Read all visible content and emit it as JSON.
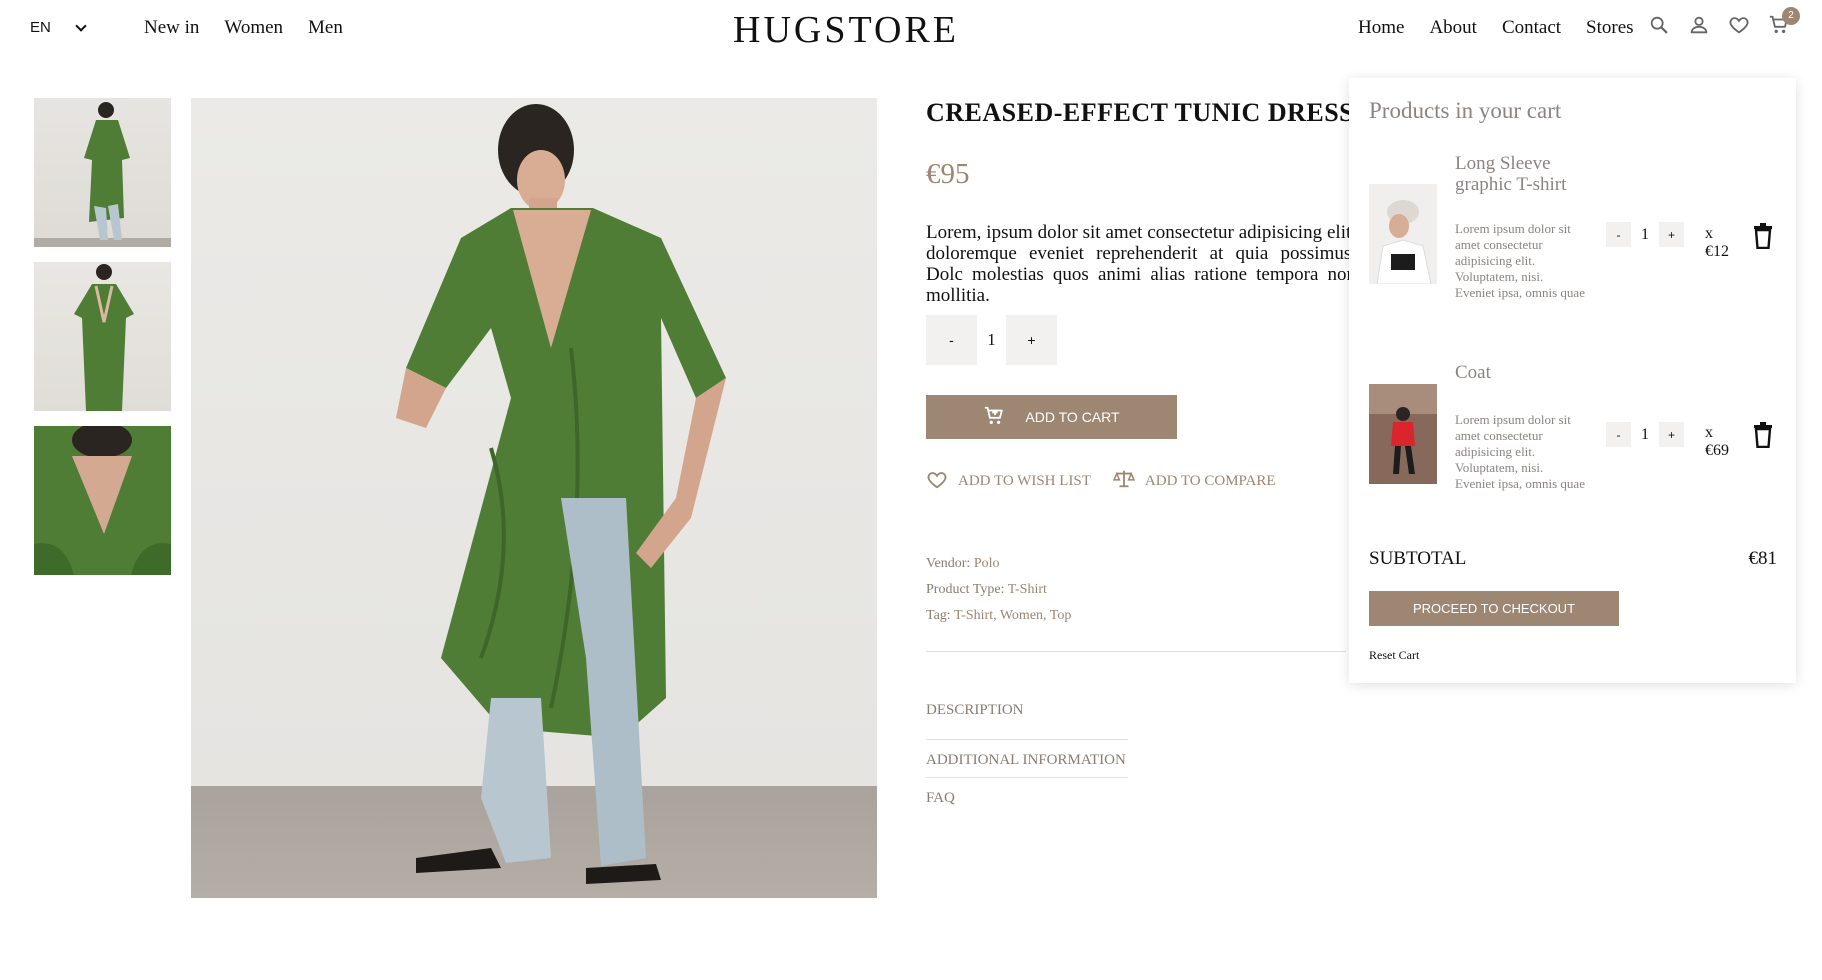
{
  "header": {
    "language": "EN",
    "nav_left": [
      "New in",
      "Women",
      "Men"
    ],
    "logo": "HUGSTORE",
    "nav_right": [
      "Home",
      "About",
      "Contact",
      "Stores"
    ],
    "cart_count": "2",
    "icons": [
      "search-icon",
      "user-icon",
      "heart-icon",
      "cart-icon"
    ]
  },
  "product": {
    "title": "CREASED-EFFECT TUNIC DRESS",
    "price": "€95",
    "description": "Lorem, ipsum dolor sit amet consectetur adipisicing elit. doloremque eveniet reprehenderit at quia possimus. Dolc molestias quos animi alias ratione tempora non mollitia.",
    "quantity": "1",
    "minus_label": "-",
    "plus_label": "+",
    "add_to_cart": "ADD TO CART",
    "wishlist": "ADD TO WISH LIST",
    "compare": "ADD TO COMPARE",
    "vendor_label": "Vendor:",
    "vendor": "Polo",
    "type_label": "Product Type:",
    "type": "T-Shirt",
    "tag_label": "Tag:",
    "tags": "T-Shirt, Women, Top",
    "tabs": [
      "DESCRIPTION",
      "ADDITIONAL INFORMATION",
      "FAQ"
    ]
  },
  "cart": {
    "title": "Products in your cart",
    "items": [
      {
        "name": "Long Sleeve graphic T-shirt",
        "desc": "Lorem ipsum dolor sit amet consectetur adipisicing elit. Voluptatem, nisi. Eveniet ipsa, omnis quae",
        "qty": "1",
        "price_x": "x",
        "price": "€12"
      },
      {
        "name": "Coat",
        "desc": "Lorem ipsum dolor sit amet consectetur adipisicing elit. Voluptatem, nisi. Eveniet ipsa, omnis quae",
        "qty": "1",
        "price_x": "x",
        "price": "€69"
      }
    ],
    "minus_label": "-",
    "plus_label": "+",
    "subtotal_label": "SUBTOTAL",
    "subtotal": "€81",
    "checkout": "PROCEED TO CHECKOUT",
    "reset": "Reset Cart"
  },
  "colors": {
    "accent": "#9d8672",
    "dress_green": "#4f7d36"
  }
}
